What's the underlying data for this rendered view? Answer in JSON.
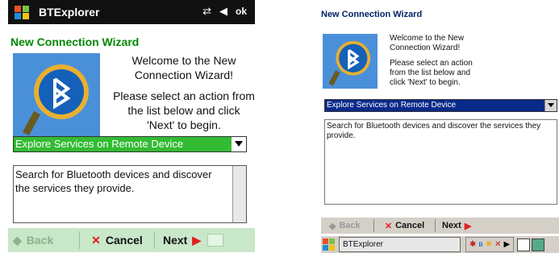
{
  "left_screen": {
    "app_title": "BTExplorer",
    "ok_label": "ok",
    "wizard_title": "New Connection Wizard",
    "welcome_line1": "Welcome to the New Connection Wizard!",
    "welcome_line2": "Please select an action from the list below and click 'Next' to begin.",
    "selected_action": "Explore Services on Remote Device",
    "description": "Search for Bluetooth devices and discover the services they provide.",
    "back_label": "Back",
    "cancel_label": "Cancel",
    "next_label": "Next",
    "colors": {
      "title_bar": "#111111",
      "accent_green": "#33bb33",
      "bottom_bar": "#c9e7c9"
    }
  },
  "right_screen": {
    "wizard_title": "New Connection Wizard",
    "welcome_line1": "Welcome to the New Connection Wizard!",
    "welcome_line2": "Please select an action from the list below and click 'Next' to begin.",
    "selected_action": "Explore Services on Remote Device",
    "description": "Search for Bluetooth devices and discover the services they provide.",
    "back_label": "Back",
    "cancel_label": "Cancel",
    "next_label": "Next",
    "taskbar_item": "BTExplorer",
    "colors": {
      "selection": "#0a2a8a",
      "chrome": "#d4d0c8"
    }
  },
  "icons": [
    "windows-start-icon",
    "bluetooth-icon",
    "connectivity-icon",
    "volume-icon",
    "dropdown-arrow-icon",
    "back-arrow-icon",
    "cancel-x-icon",
    "next-arrow-icon",
    "keyboard-icon"
  ]
}
